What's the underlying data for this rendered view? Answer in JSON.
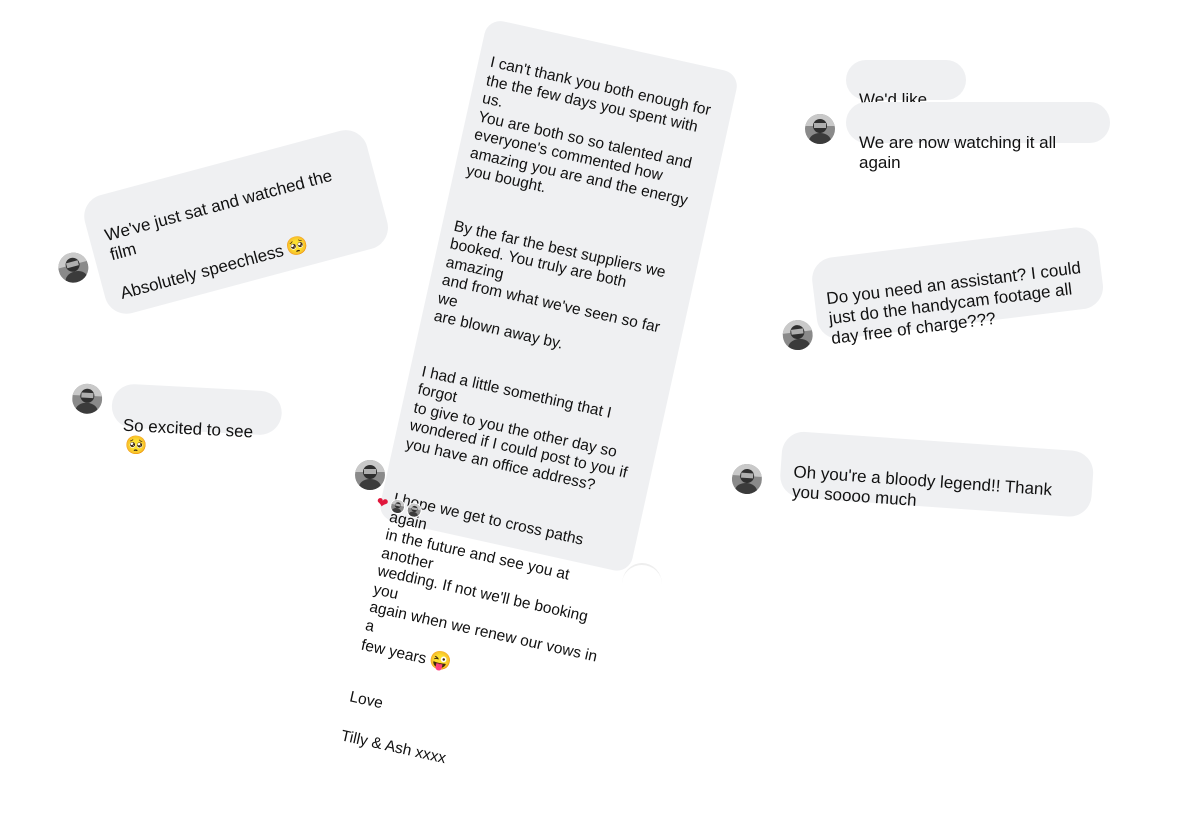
{
  "messages": {
    "film": {
      "line1": "We've just sat and watched the film",
      "line2": "Absolutely speechless"
    },
    "excited": {
      "text": "So excited to see"
    },
    "letter": {
      "p1": "I can't thank you both enough for\nthe the few days you spent with us.\nYou are both so so talented and\neveryone's commented how\namazing you are and the energy\nyou bought.",
      "p2": "By the far the best suppliers we\nbooked. You truly are both amazing\nand from what we've seen so far we\nare blown away by.",
      "p3": "I had a little something that I forgot\nto give to you the other day so\nwondered if I could post to you if\nyou have an office address?",
      "p4": "I hope we get to cross paths again\nin the future and see you at another\nwedding. If not we'll be booking you\nagain when we renew our vows in a\nfew years",
      "closing": "Love",
      "signature": "Tilly & Ash xxxx"
    },
    "like_to": {
      "text": "We'd like to!!"
    },
    "watching": {
      "text": "We are now watching it all again"
    },
    "assistant": {
      "text": "Do you need an assistant? I could\njust do the handycam footage all\nday free of charge???"
    },
    "legend": {
      "text": "Oh you're a bloody legend!! Thank\nyou soooo much"
    }
  },
  "emojis": {
    "pleading": "🥺",
    "wink_tongue": "😜",
    "heart": "❤"
  },
  "icons": {
    "avatar": "sender-avatar-icon",
    "reaction_avatar": "reaction-avatar-icon"
  },
  "colors": {
    "bubble": "#eff0f2",
    "text": "#111111",
    "heart": "#e0163b",
    "background": "#ffffff"
  }
}
